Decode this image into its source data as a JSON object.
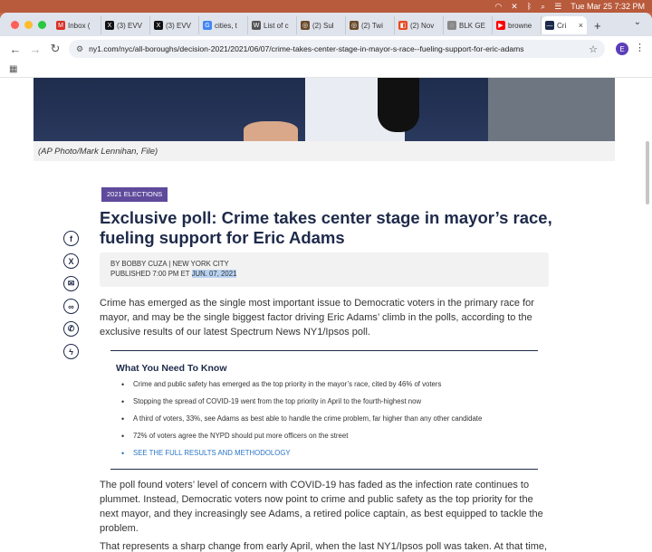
{
  "menubar": {
    "datetime": "Tue Mar 25  7:32 PM"
  },
  "tabs": [
    {
      "label": "Inbox (",
      "fav": "M",
      "color": "#d93025"
    },
    {
      "label": "(3) EVV",
      "fav": "X",
      "color": "#111111"
    },
    {
      "label": "(3) EVV",
      "fav": "X",
      "color": "#111111"
    },
    {
      "label": "cities, t",
      "fav": "G",
      "color": "#4285f4"
    },
    {
      "label": "List of c",
      "fav": "W",
      "color": "#555555"
    },
    {
      "label": "(2) Sul",
      "fav": "◎",
      "color": "#6b4b2b"
    },
    {
      "label": "(2) Twi",
      "fav": "◎",
      "color": "#6b4b2b"
    },
    {
      "label": "(2) Nov",
      "fav": "◧",
      "color": "#e8491d"
    },
    {
      "label": "BLK GE",
      "fav": "◌",
      "color": "#888888"
    },
    {
      "label": "browne",
      "fav": "▶",
      "color": "#ff0000"
    },
    {
      "label": "Cri",
      "fav": "—",
      "color": "#1e2a4a"
    }
  ],
  "address": {
    "url": "ny1.com/nyc/all-boroughs/decision-2021/2021/06/07/crime-takes-center-stage-in-mayor-s-race--fueling-support-for-eric-adams"
  },
  "profile": {
    "initial": "E"
  },
  "article": {
    "caption": "(AP Photo/Mark Lennihan, File)",
    "badge": "2021 ELECTIONS",
    "headline": "Exclusive poll: Crime takes center stage in mayor’s race, fueling support for Eric Adams",
    "byline": "BY BOBBY CUZA | NEW YORK CITY",
    "published_prefix": "PUBLISHED 7:00 PM ET ",
    "published_date": "JUN. 07, 2021",
    "lead": "Crime has emerged as the single most important issue to Democratic voters in the primary race for mayor, and may be the single biggest factor driving Eric Adams’ climb in the polls, according to the exclusive results of our latest Spectrum News NY1/Ipsos poll.",
    "wyntk_title": "What You Need To Know",
    "wyntk_items": [
      "Crime and public safety has emerged as the top priority in the mayor’s race, cited by 46% of voters",
      "Stopping the spread of COVID-19 went from the top priority in April to the fourth-highest now",
      "A third of voters, 33%, see Adams as best able to handle the crime problem, far higher than any other candidate",
      "72% of voters agree the NYPD should put more officers on the street"
    ],
    "wyntk_link": "SEE THE FULL RESULTS AND METHODOLOGY",
    "para2": "The poll found voters’ level of concern with COVID-19 has faded as the infection rate continues to plummet. Instead, Democratic voters now point to crime and public safety as the top priority for the next mayor, and they increasingly see Adams, a retired police captain, as best equipped to tackle the problem.",
    "para3": "That represents a sharp change from early April, when the last NY1/Ipsos poll was taken. At that time, an equal percentage of voters saw Adams and Andrew Yang as best able to fight crime."
  }
}
